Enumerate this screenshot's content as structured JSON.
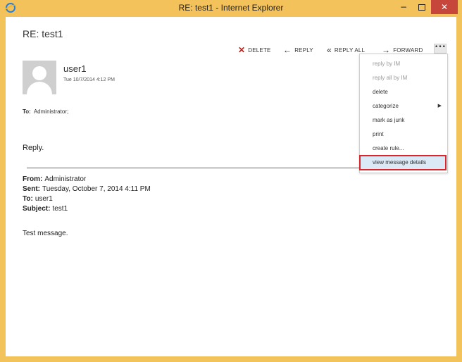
{
  "window": {
    "title": "RE: test1 - Internet Explorer",
    "controls": {
      "minimize": "−",
      "close": "✕"
    }
  },
  "message": {
    "subject": "RE: test1",
    "sender": "user1",
    "date": "Tue 10/7/2014 4:12 PM",
    "to_label": "To:",
    "to_value": "Administrator;",
    "body": "Reply."
  },
  "toolbar": {
    "delete": "DELETE",
    "reply": "REPLY",
    "reply_all": "REPLY ALL",
    "forward": "FORWARD",
    "more": "•••",
    "icons": {
      "delete": "✕",
      "reply": "←",
      "reply_all": "«",
      "forward": "→"
    }
  },
  "quoted": {
    "from_label": "From:",
    "from": "Administrator",
    "sent_label": "Sent:",
    "sent": "Tuesday, October 7, 2014 4:11 PM",
    "to_label": "To:",
    "to": "user1",
    "subject_label": "Subject:",
    "subject": "test1",
    "body": "Test message."
  },
  "menu": {
    "items": [
      {
        "label": "reply by IM",
        "disabled": true
      },
      {
        "label": "reply all by IM",
        "disabled": true
      },
      {
        "label": "delete",
        "disabled": false
      },
      {
        "label": "categorize",
        "disabled": false,
        "submenu": true
      },
      {
        "label": "mark as junk",
        "disabled": false
      },
      {
        "label": "print",
        "disabled": false
      },
      {
        "label": "create rule...",
        "disabled": false
      },
      {
        "label": "view message details",
        "disabled": false,
        "selected": true
      }
    ],
    "submenu_arrow": "▶"
  },
  "colors": {
    "frame": "#f2c35a",
    "close_button": "#c7463c",
    "delete_icon": "#c0201a",
    "highlight_border": "#d9262d",
    "selected_bg": "#dbe8f6"
  }
}
